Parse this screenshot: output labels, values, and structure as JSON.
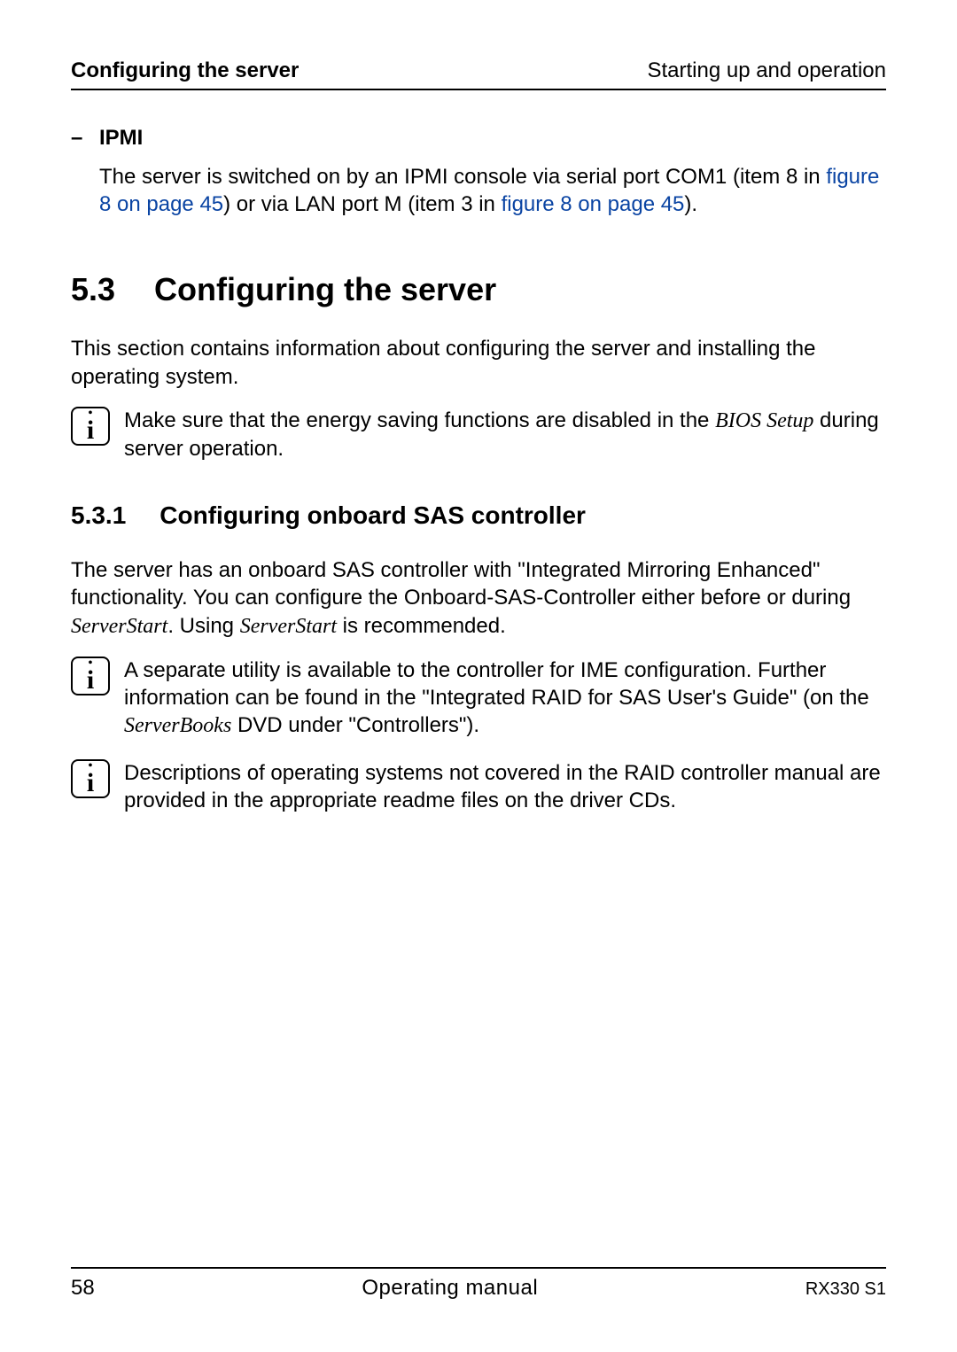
{
  "header": {
    "left": "Configuring the server",
    "right": "Starting up and operation"
  },
  "ipmi": {
    "dash": "–",
    "label": "IPMI",
    "body_before": "The server is switched on by an IPMI console via serial port COM1 (item 8 in ",
    "link1": "figure 8 on page 45",
    "body_mid": ") or via LAN port M (item 3 in ",
    "link2": "figure 8 on page 45",
    "body_after": ")."
  },
  "section": {
    "num": "5.3",
    "title": "Configuring the server",
    "intro": "This section contains information about configuring the server and installing the operating system."
  },
  "info1": {
    "t1": "Make sure that the energy saving functions are disabled in the ",
    "em": "BIOS Setup",
    "t2": " during server operation."
  },
  "subsection": {
    "num": "5.3.1",
    "title": "Configuring onboard SAS controller",
    "p_a": "The server has an onboard SAS controller with \"Integrated Mirroring Enhanced\" functionality. You can configure the Onboard-SAS-Controller either before or during ",
    "em1": "ServerStart",
    "p_b": ". Using ",
    "em2": "ServerStart",
    "p_c": " is recommended."
  },
  "info2": {
    "t1": "A separate utility is available to the controller for IME configuration. Further information can be found in the \"Integrated RAID for SAS User's Guide\" (on the ",
    "em": "ServerBooks",
    "t2": " DVD under \"Controllers\")."
  },
  "info3": {
    "t": "Descriptions of operating systems not covered in the RAID controller manual are provided in the appropriate readme files on the driver CDs."
  },
  "footer": {
    "page": "58",
    "center": "Operating manual",
    "right": "RX330 S1"
  },
  "icon_glyph": "i"
}
